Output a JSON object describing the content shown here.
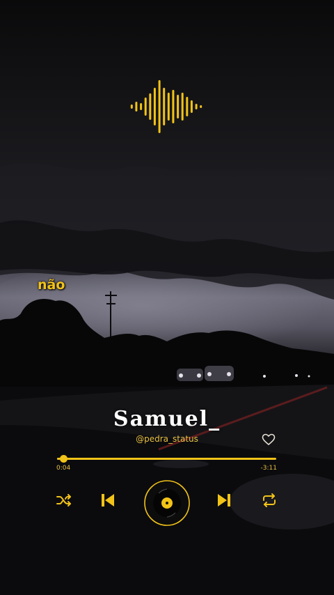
{
  "overlay": {
    "caption": "não"
  },
  "player": {
    "title": "Samuel_",
    "handle": "@pedra_status",
    "elapsed": "0:04",
    "remaining": "-3:11",
    "progress_fraction": 0.03,
    "liked": false
  },
  "icons": {
    "waveform": "audio-waveform-icon",
    "heart": "heart-outline-icon",
    "shuffle": "shuffle-icon",
    "previous": "skip-previous-icon",
    "play": "vinyl-disc-icon",
    "next": "skip-next-icon",
    "repeat": "repeat-icon"
  },
  "colors": {
    "accent": "#f2c318",
    "text": "#ffffff",
    "background": "#0b0b0d"
  }
}
